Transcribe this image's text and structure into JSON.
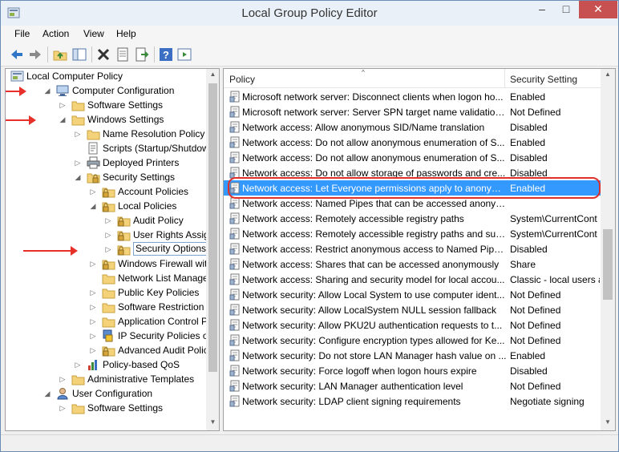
{
  "window": {
    "title": "Local Group Policy Editor",
    "close_glyph": "✕",
    "minimize_glyph": "–",
    "maximize_glyph": "□"
  },
  "menu": [
    "File",
    "Action",
    "View",
    "Help"
  ],
  "toolbar": {
    "icons": [
      "back-arrow-icon",
      "forward-arrow-icon",
      "up-folder-icon",
      "show-hide-tree-icon",
      "delete-icon",
      "properties-icon",
      "export-list-icon",
      "help-icon",
      "extended-view-icon"
    ]
  },
  "tree": {
    "items": [
      {
        "label": "Local Computer Policy",
        "level": 0,
        "expander": "",
        "icon": "computer-policy-icon"
      },
      {
        "label": "Computer Configuration",
        "level": 1,
        "expander": "open",
        "icon": "computer-icon"
      },
      {
        "label": "Software Settings",
        "level": 2,
        "expander": "closed",
        "icon": "folder-icon"
      },
      {
        "label": "Windows Settings",
        "level": 2,
        "expander": "open",
        "icon": "folder-icon"
      },
      {
        "label": "Name Resolution Policy",
        "level": 3,
        "expander": "closed",
        "icon": "folder-icon"
      },
      {
        "label": "Scripts (Startup/Shutdown)",
        "level": 3,
        "expander": "",
        "icon": "scripts-icon"
      },
      {
        "label": "Deployed Printers",
        "level": 3,
        "expander": "closed",
        "icon": "printer-icon"
      },
      {
        "label": "Security Settings",
        "level": 3,
        "expander": "open",
        "icon": "security-settings-icon"
      },
      {
        "label": "Account Policies",
        "level": 4,
        "expander": "closed",
        "icon": "locked-folder-icon"
      },
      {
        "label": "Local Policies",
        "level": 4,
        "expander": "open",
        "icon": "locked-folder-icon"
      },
      {
        "label": "Audit Policy",
        "level": 5,
        "expander": "closed",
        "icon": "locked-folder-icon"
      },
      {
        "label": "User Rights Assignment",
        "level": 5,
        "expander": "closed",
        "icon": "locked-folder-icon"
      },
      {
        "label": "Security Options",
        "level": 5,
        "expander": "closed",
        "icon": "locked-folder-icon",
        "selected": true
      },
      {
        "label": "Windows Firewall with Adva",
        "level": 4,
        "expander": "closed",
        "icon": "locked-folder-icon"
      },
      {
        "label": "Network List Manager Polic",
        "level": 4,
        "expander": "",
        "icon": "folder-icon"
      },
      {
        "label": "Public Key Policies",
        "level": 4,
        "expander": "closed",
        "icon": "folder-icon"
      },
      {
        "label": "Software Restriction Policies",
        "level": 4,
        "expander": "closed",
        "icon": "folder-icon"
      },
      {
        "label": "Application Control Policies",
        "level": 4,
        "expander": "closed",
        "icon": "folder-icon"
      },
      {
        "label": "IP Security Policies on Local",
        "level": 4,
        "expander": "closed",
        "icon": "ip-security-icon"
      },
      {
        "label": "Advanced Audit Policy Con",
        "level": 4,
        "expander": "closed",
        "icon": "locked-folder-icon"
      },
      {
        "label": "Policy-based QoS",
        "level": 3,
        "expander": "closed",
        "icon": "qos-chart-icon"
      },
      {
        "label": "Administrative Templates",
        "level": 2,
        "expander": "closed",
        "icon": "folder-icon"
      },
      {
        "label": "User Configuration",
        "level": 1,
        "expander": "open",
        "icon": "user-icon"
      },
      {
        "label": "Software Settings",
        "level": 2,
        "expander": "closed",
        "icon": "folder-icon"
      }
    ]
  },
  "list": {
    "columns": {
      "policy": "Policy",
      "setting": "Security Setting"
    },
    "rows": [
      {
        "policy": "Microsoft network server: Disconnect clients when logon ho...",
        "setting": "Enabled"
      },
      {
        "policy": "Microsoft network server: Server SPN target name validation...",
        "setting": "Not Defined"
      },
      {
        "policy": "Network access: Allow anonymous SID/Name translation",
        "setting": "Disabled"
      },
      {
        "policy": "Network access: Do not allow anonymous enumeration of S...",
        "setting": "Enabled"
      },
      {
        "policy": "Network access: Do not allow anonymous enumeration of S...",
        "setting": "Disabled"
      },
      {
        "policy": "Network access: Do not allow storage of passwords and cre...",
        "setting": "Disabled"
      },
      {
        "policy": "Network access: Let Everyone permissions apply to anonym...",
        "setting": "Enabled",
        "selected": true
      },
      {
        "policy": "Network access: Named Pipes that can be accessed anonym...",
        "setting": ""
      },
      {
        "policy": "Network access: Remotely accessible registry paths",
        "setting": "System\\CurrentCont"
      },
      {
        "policy": "Network access: Remotely accessible registry paths and sub...",
        "setting": "System\\CurrentCont"
      },
      {
        "policy": "Network access: Restrict anonymous access to Named Pipes...",
        "setting": "Disabled"
      },
      {
        "policy": "Network access: Shares that can be accessed anonymously",
        "setting": "Share"
      },
      {
        "policy": "Network access: Sharing and security model for local accou...",
        "setting": "Classic - local users a"
      },
      {
        "policy": "Network security: Allow Local System to use computer ident...",
        "setting": "Not Defined"
      },
      {
        "policy": "Network security: Allow LocalSystem NULL session fallback",
        "setting": "Not Defined"
      },
      {
        "policy": "Network security: Allow PKU2U authentication requests to t...",
        "setting": "Not Defined"
      },
      {
        "policy": "Network security: Configure encryption types allowed for Ke...",
        "setting": "Not Defined"
      },
      {
        "policy": "Network security: Do not store LAN Manager hash value on ...",
        "setting": "Enabled"
      },
      {
        "policy": "Network security: Force logoff when logon hours expire",
        "setting": "Disabled"
      },
      {
        "policy": "Network security: LAN Manager authentication level",
        "setting": "Not Defined"
      },
      {
        "policy": "Network security: LDAP client signing requirements",
        "setting": "Negotiate signing"
      }
    ]
  },
  "colors": {
    "selection": "#3399ff",
    "annotation": "#e8302a",
    "folder": "#f3d27a"
  }
}
